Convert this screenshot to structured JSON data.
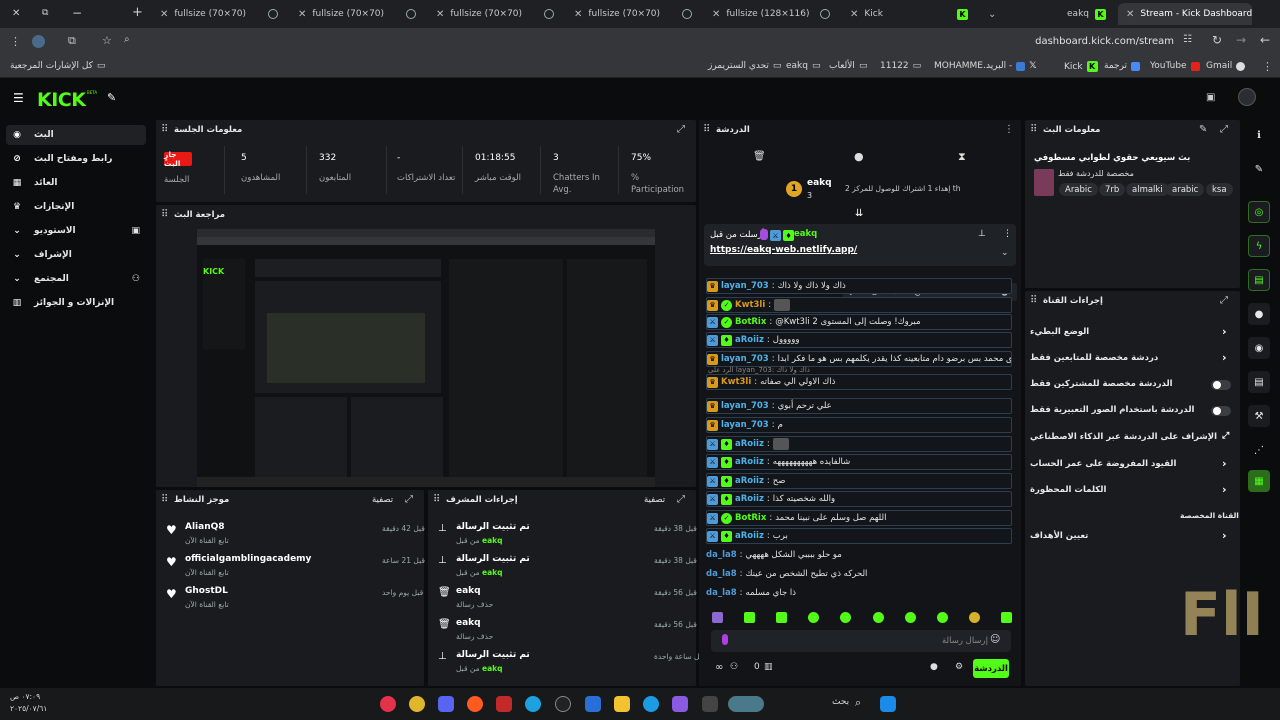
{
  "browser": {
    "tabs": [
      {
        "title": "fullsize (70×70)"
      },
      {
        "title": "fullsize (70×70)"
      },
      {
        "title": "fullsize (70×70)"
      },
      {
        "title": "fullsize (70×70)"
      },
      {
        "title": "fullsize (128×116)"
      },
      {
        "title": "Kick"
      },
      {
        "title": "eakq"
      },
      {
        "title": "Stream - Kick Dashboard"
      }
    ],
    "url": "dashboard.kick.com/stream",
    "bookmarks": {
      "all": "كل الإشارات المرجعية",
      "challenge": "تحدي الستريمرز",
      "eakq": "eakq",
      "games": "الألعاب",
      "num": "11122",
      "mohamme": "MOHAMME...",
      "mail": "البريد -",
      "kick": "Kick",
      "translate": "ترجمة",
      "youtube": "YouTube",
      "gmail": "Gmail"
    }
  },
  "sidebar": {
    "items": [
      {
        "label": "البث"
      },
      {
        "label": "رابط ومفتاح البث"
      },
      {
        "label": "العائد"
      },
      {
        "label": "الإنجازات"
      },
      {
        "label": "الاستوديو"
      },
      {
        "label": "الإشراف"
      },
      {
        "label": "المجتمع"
      },
      {
        "label": "الإنزالات و الجوائز"
      }
    ]
  },
  "session": {
    "title": "معلومات الجلسة",
    "live_badge": "جارٍ البث",
    "live_label": "الجلسة",
    "stats": [
      {
        "value": "5",
        "label": "المشاهدون"
      },
      {
        "value": "332",
        "label": "المتابعون"
      },
      {
        "value": "-",
        "label": "تعداد الاشتراكات"
      },
      {
        "value": "01:18:55",
        "label": "الوقت مباشر"
      },
      {
        "value": "3",
        "label": "Chatters In Avg."
      },
      {
        "value": "75%",
        "label": "% Participation"
      }
    ]
  },
  "preview": {
    "title": "مراجعة البث"
  },
  "activity": {
    "title": "موجز النشاط",
    "filter": "تصفية",
    "items": [
      {
        "name": "AlianQ8",
        "sub": "تابع القناة الآن",
        "time": "قبل 42 دقيقة"
      },
      {
        "name": "officialgamblingacademy",
        "sub": "تابع القناة الآن",
        "time": "قبل 21 ساعة"
      },
      {
        "name": "GhostDL",
        "sub": "تابع القناة الآن",
        "time": "قبل يوم واحد"
      }
    ]
  },
  "modactions": {
    "title": "إجراءات المشرف",
    "filter": "تصفية",
    "items": [
      {
        "action": "تم تثبيت الرسالة",
        "by_prefix": "من قبل",
        "by": "eakq",
        "time": "قبل 38 دقيقة"
      },
      {
        "action": "تم تثبيت الرسالة",
        "by_prefix": "من قبل",
        "by": "eakq",
        "time": "قبل 38 دقيقة"
      },
      {
        "action": "eakq",
        "by_prefix": "حذف رسالة",
        "by": "",
        "time": "قبل 56 دقيقة"
      },
      {
        "action": "eakq",
        "by_prefix": "حذف رسالة",
        "by": "",
        "time": "قبل 56 دقيقة"
      },
      {
        "action": "تم تثبيت الرسالة",
        "by_prefix": "من قبل",
        "by": "eakq",
        "time": "قبل ساعة واحدة"
      }
    ]
  },
  "chat": {
    "title": "الدردشة",
    "leader": {
      "rank": "1",
      "name": "eakq",
      "count": "3",
      "goal_text": "إهداء 1 اشتراك للوصول للمركز 2 th"
    },
    "pinned": {
      "by_label": "أرسلت من قبل",
      "user": "eakq",
      "link": "https://eakq-web.netlify.app/"
    },
    "messages": [
      {
        "user": "Kwt3li",
        "color": "#d99a1c",
        "badges": [
          "sub"
        ],
        "text": ""
      },
      {
        "user": "layan_703",
        "color": "#4fb2e8",
        "badges": [
          "sub"
        ],
        "text": "ذاك ولا ذاك ولا ذاك"
      },
      {
        "user": "Kwt3li",
        "color": "#d99a1c",
        "badges": [
          "sub",
          "ver"
        ],
        "text": ""
      },
      {
        "user": "BotRix",
        "color": "#53fc18",
        "badges": [
          "bot",
          "ver"
        ],
        "text": "@Kwt3li مبروك! وصلت إلى المستوى 2"
      },
      {
        "user": "aRoiiz",
        "color": "#4fb2e8",
        "badges": [
          "mod",
          "vip"
        ],
        "text": "ووووول"
      },
      {
        "user": "layan_703",
        "color": "#4fb2e8",
        "badges": [
          "sub"
        ],
        "text": "اتفق محمد بس برضو دام متابعينه كذا يقدر يكلمهم بس هو ما فكر ابدا"
      },
      {
        "user": "Kwt3li",
        "color": "#d99a1c",
        "badges": [
          "sub"
        ],
        "text": "ذاك الاولي الي صفاته",
        "reply": "الرد على layan_703: ذاك ولا ذاك"
      },
      {
        "user": "layan_703",
        "color": "#4fb2e8",
        "badges": [
          "sub"
        ],
        "text": "علي ترحم أبوي"
      },
      {
        "user": "layan_703",
        "color": "#4fb2e8",
        "badges": [
          "sub"
        ],
        "text": "م"
      },
      {
        "user": "aRoiiz",
        "color": "#4fb2e8",
        "badges": [
          "mod",
          "vip"
        ],
        "text": ""
      },
      {
        "user": "aRoiiz",
        "color": "#4fb2e8",
        "badges": [
          "mod",
          "vip"
        ],
        "text": "شالفايده ههههههههههه"
      },
      {
        "user": "aRoiiz",
        "color": "#4fb2e8",
        "badges": [
          "mod",
          "vip"
        ],
        "text": "صح"
      },
      {
        "user": "aRoiiz",
        "color": "#4fb2e8",
        "badges": [
          "mod",
          "vip"
        ],
        "text": "والله شخصيته كذا"
      },
      {
        "user": "BotRix",
        "color": "#53fc18",
        "badges": [
          "bot",
          "ver"
        ],
        "text": "اللهم صل وسلم على نبينا محمد"
      },
      {
        "user": "aRoiiz",
        "color": "#4fb2e8",
        "badges": [
          "mod",
          "vip"
        ],
        "text": "برب"
      },
      {
        "user": "da_la8",
        "color": "#4f9bd8",
        "badges": [],
        "text": "مو حلو ببببي الشكل ههههي"
      },
      {
        "user": "da_la8",
        "color": "#4f9bd8",
        "badges": [],
        "text": "الحركه ذي تطيح الشخص من عينك"
      },
      {
        "user": "da_la8",
        "color": "#4f9bd8",
        "badges": [],
        "text": "ذا جاي مسلمه"
      }
    ],
    "input_placeholder": "إرسال رسالة",
    "viewer_count": "0",
    "send_label": "الدردشة"
  },
  "stream_info": {
    "title": "معلومات البث",
    "stream_title": "بث سيويعي حقوي لطوابي مسطوفي",
    "category": "مخصصة للدردشة فقط",
    "tags": [
      "Arabic",
      "7rb",
      "almalki",
      "arabic",
      "ksa"
    ]
  },
  "channel_actions": {
    "title": "إجراءات القناة",
    "items": [
      {
        "label": "الوضع البطيء",
        "control": "chevron"
      },
      {
        "label": "دردشة مخصصة للمتابعين فقط",
        "control": "chevron"
      },
      {
        "label": "الدردشة مخصصة للمشتركين فقط",
        "control": "toggle"
      },
      {
        "label": "الدردشة باستخدام الصور التعبيرية فقط",
        "control": "toggle"
      },
      {
        "label": "الإشراف على الدردشة عبر الذكاء الاصطناعي",
        "control": "external"
      },
      {
        "label": "القيود المفروضة على عمر الحساب",
        "control": "chevron"
      },
      {
        "label": "الكلمات المحظورة",
        "control": "chevron"
      },
      {
        "label": "القناة المخصصة",
        "control": "none"
      },
      {
        "label": "تعيين الأهداف",
        "control": "chevron"
      }
    ]
  },
  "taskbar": {
    "search": "بحث",
    "time": "٠٧:٠٩ ص",
    "date": "٢٠٢٥/٠٧/٦١"
  }
}
